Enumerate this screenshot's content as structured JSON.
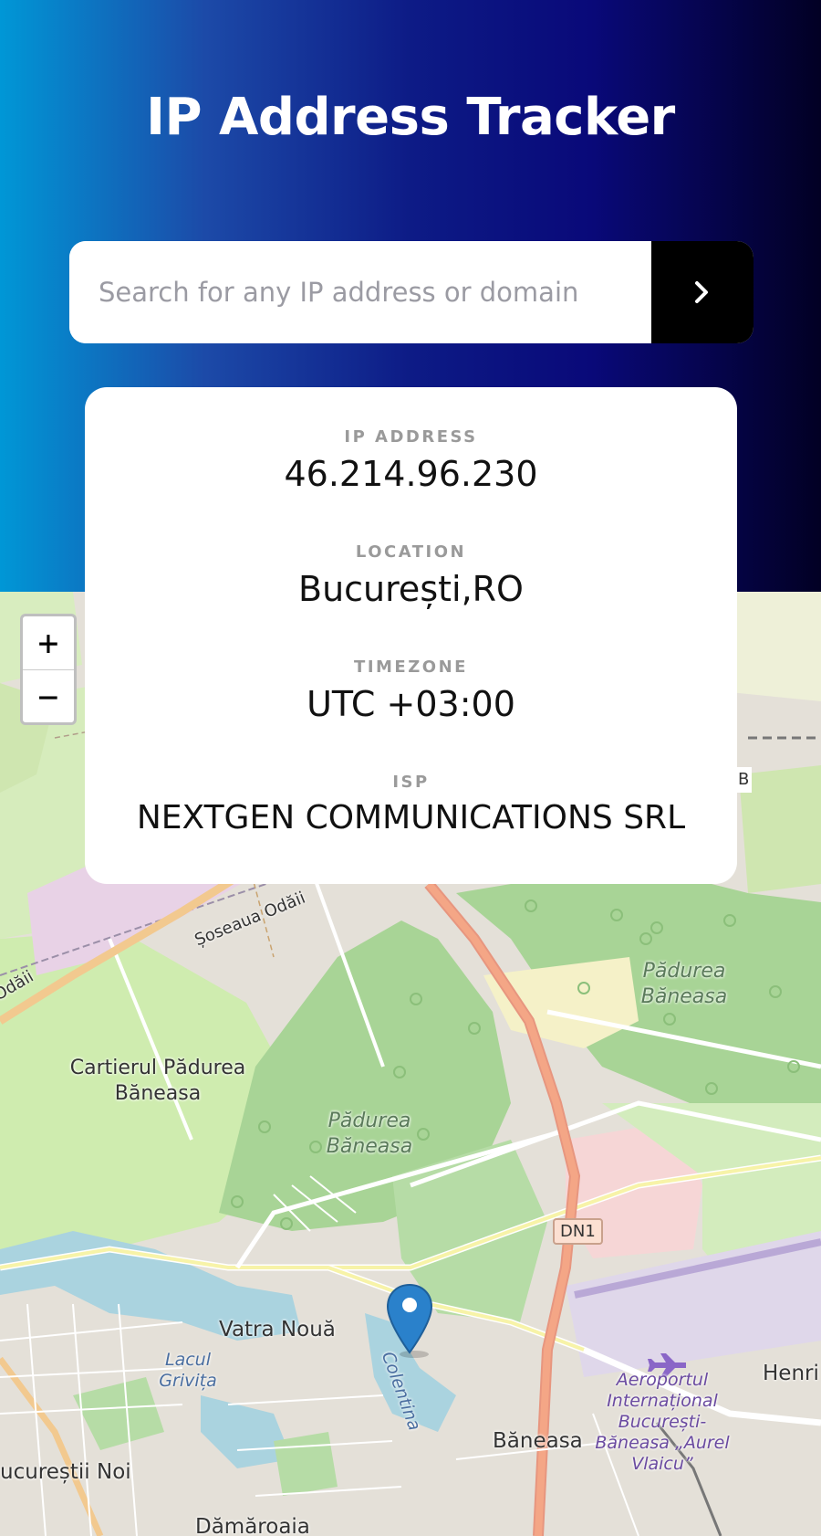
{
  "app": {
    "title": "IP Address Tracker"
  },
  "search": {
    "placeholder": "Search for any IP address or domain",
    "value": "",
    "submit_icon": "chevron-right-icon"
  },
  "info": {
    "ip": {
      "label": "IP ADDRESS",
      "value": "46.214.96.230"
    },
    "location": {
      "label": "LOCATION",
      "value": "București,RO"
    },
    "timezone": {
      "label": "TIMEZONE",
      "value": "UTC +03:00"
    },
    "isp": {
      "label": "ISP",
      "value": "NEXTGEN COMMUNICATIONS SRL"
    }
  },
  "map": {
    "zoom_in": "+",
    "zoom_out": "−",
    "labels": {
      "soseaua_odaii": "Șoseaua Odăii",
      "odaii": "Odăii",
      "cartierul": "Cartierul Pădurea Băneasa",
      "padurea_1": "Pădurea Băneasa",
      "padurea_2": "Pădurea Băneasa",
      "dn1": "DN1",
      "vatra_noua": "Vatra Nouă",
      "lacul": "Lacul Grivița",
      "colentina": "Colentina",
      "baneasa": "Băneasa",
      "aeroport": "Aeroportul Internațional București-Băneasa „Aurel Vlaicu”",
      "henri": "Henri",
      "bucurestii_noi": "ucureștii Noi",
      "damaroaia": "Dămăroaia",
      "b": "B"
    }
  },
  "colors": {
    "gradient": [
      "#0097d6",
      "#0d1b86",
      "#020024"
    ],
    "card_bg": "#ffffff",
    "button_bg": "#000000",
    "label_gray": "#9a9a9a",
    "pin_blue": "#2a81cb"
  }
}
